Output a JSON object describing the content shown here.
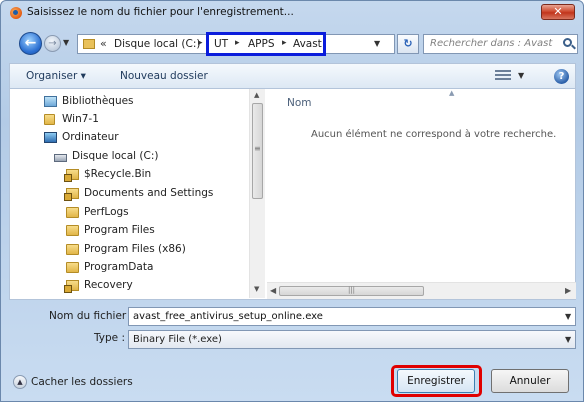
{
  "window": {
    "title": "Saisissez le nom du fichier pour l'enregistrement...",
    "close_label": "✕"
  },
  "address_bar": {
    "overflow_chevron": "«",
    "drive": "Disque local (C:)",
    "segments": [
      "UT",
      "APPS",
      "Avast"
    ],
    "separator": "▸"
  },
  "search": {
    "placeholder": "Rechercher dans : Avast"
  },
  "toolbar": {
    "organize_label": "Organiser ▾",
    "new_folder_label": "Nouveau dossier",
    "help_label": "?"
  },
  "nav_tree": [
    {
      "label": "Bibliothèques",
      "icon": "library-icon"
    },
    {
      "label": "Win7-1",
      "icon": "user-icon"
    },
    {
      "label": "Ordinateur",
      "icon": "computer-icon"
    },
    {
      "label": "Disque local (C:)",
      "icon": "drive-icon"
    },
    {
      "label": "$Recycle.Bin",
      "icon": "locked-folder-icon"
    },
    {
      "label": "Documents and Settings",
      "icon": "locked-folder-icon"
    },
    {
      "label": "PerfLogs",
      "icon": "folder-icon"
    },
    {
      "label": "Program Files",
      "icon": "folder-icon"
    },
    {
      "label": "Program Files (x86)",
      "icon": "folder-icon"
    },
    {
      "label": "ProgramData",
      "icon": "folder-icon"
    },
    {
      "label": "Recovery",
      "icon": "locked-folder-icon"
    }
  ],
  "file_list": {
    "column_name": "Nom",
    "empty_message": "Aucun élément ne correspond à votre recherche."
  },
  "form": {
    "filename_label": "Nom du fichier :",
    "filename_value": "avast_free_antivirus_setup_online.exe",
    "type_label": "Type :",
    "type_value": "Binary File (*.exe)"
  },
  "footer": {
    "hide_folders_label": "Cacher les dossiers",
    "save_label": "Enregistrer",
    "cancel_label": "Annuler"
  },
  "colors": {
    "address_highlight": "#0b1ddc",
    "save_highlight": "#e00000"
  }
}
